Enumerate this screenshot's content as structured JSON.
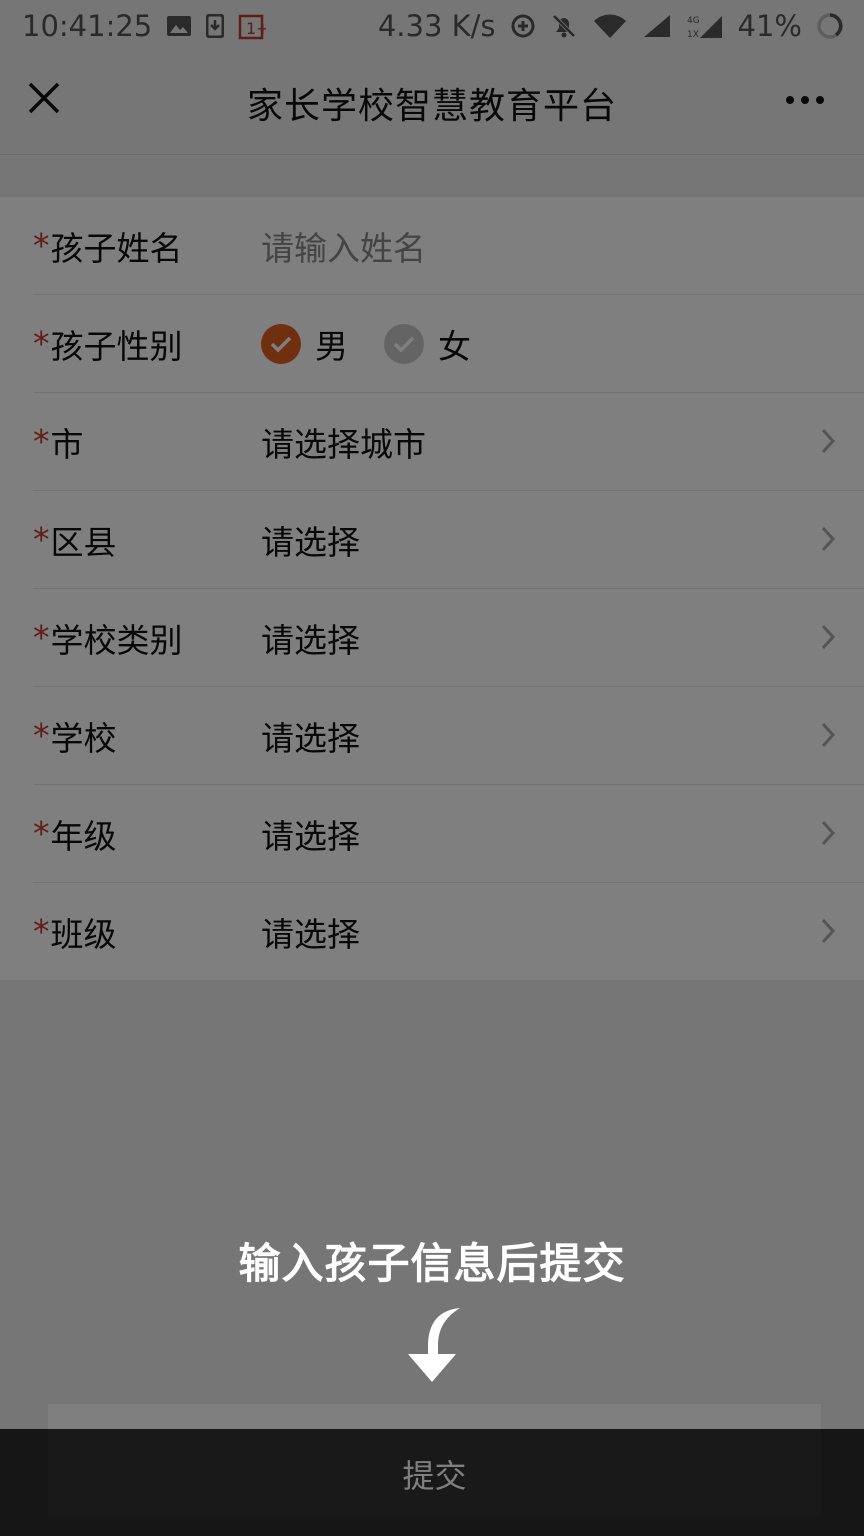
{
  "status_bar": {
    "time": "10:41:25",
    "net_speed": "4.33 K/s",
    "network": "4G 1X",
    "battery": "41%",
    "carrier_icon": "1+",
    "icons": [
      "image-icon",
      "download-icon",
      "oneplus-icon",
      "data-saver-icon",
      "mute-bell-icon",
      "wifi-icon",
      "signal-icon",
      "battery-icon"
    ]
  },
  "navbar": {
    "title": "家长学校智慧教育平台",
    "close_icon": "close-icon",
    "more_icon": "more-icon"
  },
  "form": {
    "required_mark": "*",
    "name": {
      "label": "孩子姓名",
      "placeholder": "请输入姓名"
    },
    "gender": {
      "label": "孩子性别",
      "options": [
        "男",
        "女"
      ],
      "selected": "男"
    },
    "city": {
      "label": "市",
      "value": "请选择城市"
    },
    "district": {
      "label": "区县",
      "value": "请选择"
    },
    "school_type": {
      "label": "学校类别",
      "value": "请选择"
    },
    "school": {
      "label": "学校",
      "value": "请选择"
    },
    "grade": {
      "label": "年级",
      "value": "请选择"
    },
    "class": {
      "label": "班级",
      "value": "请选择"
    }
  },
  "colors": {
    "accent": "#e0601f",
    "required": "#c0392b",
    "submit_bg": "#333333"
  },
  "submit": {
    "label": "提交"
  },
  "overlay": {
    "hint": "输入孩子信息后提交",
    "arrow_icon": "curved-arrow-down-icon"
  }
}
